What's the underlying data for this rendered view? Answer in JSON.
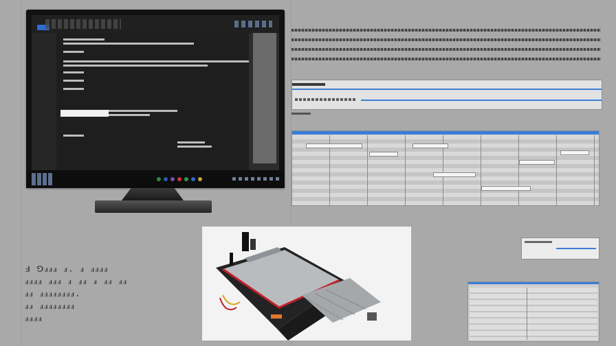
{
  "caption": {
    "lines": [
      "Ⅎ ⅁ⅎⅎⅎ ⅎ.    ⅎ ⅎⅎⅎⅎ",
      "ⅎⅎⅎⅎ ⅎⅎⅎ ⅎ ⅎⅎ ⅎ ⅎⅎ ⅎⅎ",
      "ⅎⅎ ⅎⅎⅎⅎⅎⅎⅎⅎ.",
      "ⅎⅎ ⅎⅎⅎⅎⅎⅎⅎⅎ",
      "ⅎⅎⅎⅎ"
    ]
  },
  "colors": {
    "background": "#a9a9a9",
    "accent_blue": "#3c7dd6",
    "saw_body": "#232323",
    "saw_trim": "#c0202a",
    "saw_table": "#b9bcbf"
  },
  "icons": {
    "product": "table-saw-image",
    "monitor": "computer-monitor-image"
  }
}
